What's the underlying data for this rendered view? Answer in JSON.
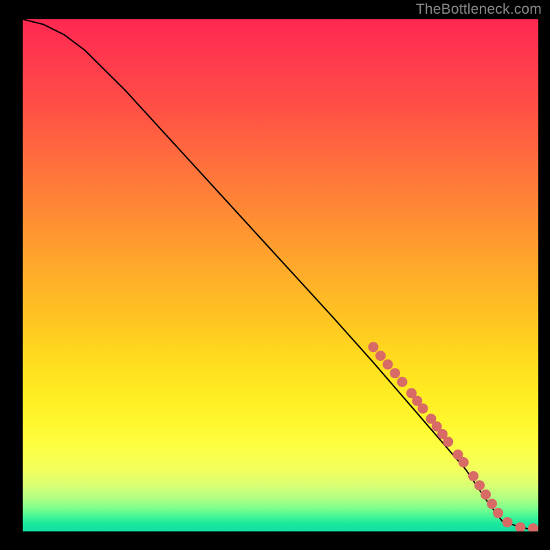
{
  "attribution": "TheBottleneck.com",
  "chart_data": {
    "type": "line",
    "title": "",
    "xlabel": "",
    "ylabel": "",
    "xlim": [
      0,
      100
    ],
    "ylim": [
      0,
      100
    ],
    "curve": {
      "name": "bottleneck-curve",
      "x": [
        0,
        4,
        8,
        12,
        20,
        30,
        40,
        50,
        60,
        68,
        74,
        80,
        86,
        90,
        93,
        96,
        98,
        100
      ],
      "y": [
        100,
        99,
        97,
        94,
        86,
        75,
        64,
        53,
        42,
        33,
        26,
        19,
        12,
        6,
        2,
        1,
        0.5,
        0.5
      ]
    },
    "highlight_segments": {
      "name": "highlighted-range",
      "color": "#d86b66",
      "points": [
        {
          "x": 68.0,
          "y": 36.0
        },
        {
          "x": 69.4,
          "y": 34.3
        },
        {
          "x": 70.8,
          "y": 32.6
        },
        {
          "x": 72.2,
          "y": 30.9
        },
        {
          "x": 73.6,
          "y": 29.2
        },
        {
          "x": 75.4,
          "y": 27.0
        },
        {
          "x": 76.5,
          "y": 25.5
        },
        {
          "x": 77.6,
          "y": 24.0
        },
        {
          "x": 79.2,
          "y": 22.0
        },
        {
          "x": 80.3,
          "y": 20.5
        },
        {
          "x": 81.4,
          "y": 19.0
        },
        {
          "x": 82.5,
          "y": 17.5
        },
        {
          "x": 84.4,
          "y": 15.0
        },
        {
          "x": 85.5,
          "y": 13.5
        },
        {
          "x": 87.4,
          "y": 10.8
        },
        {
          "x": 88.6,
          "y": 9.0
        },
        {
          "x": 89.8,
          "y": 7.2
        },
        {
          "x": 91.0,
          "y": 5.4
        },
        {
          "x": 92.2,
          "y": 3.6
        },
        {
          "x": 94.0,
          "y": 1.8
        },
        {
          "x": 96.5,
          "y": 0.8
        },
        {
          "x": 99.0,
          "y": 0.6
        }
      ]
    },
    "gradient_stops": [
      {
        "pos": 0,
        "color": "#ff2850"
      },
      {
        "pos": 50,
        "color": "#ffb728"
      },
      {
        "pos": 80,
        "color": "#fff82f"
      },
      {
        "pos": 100,
        "color": "#12e0a2"
      }
    ]
  }
}
